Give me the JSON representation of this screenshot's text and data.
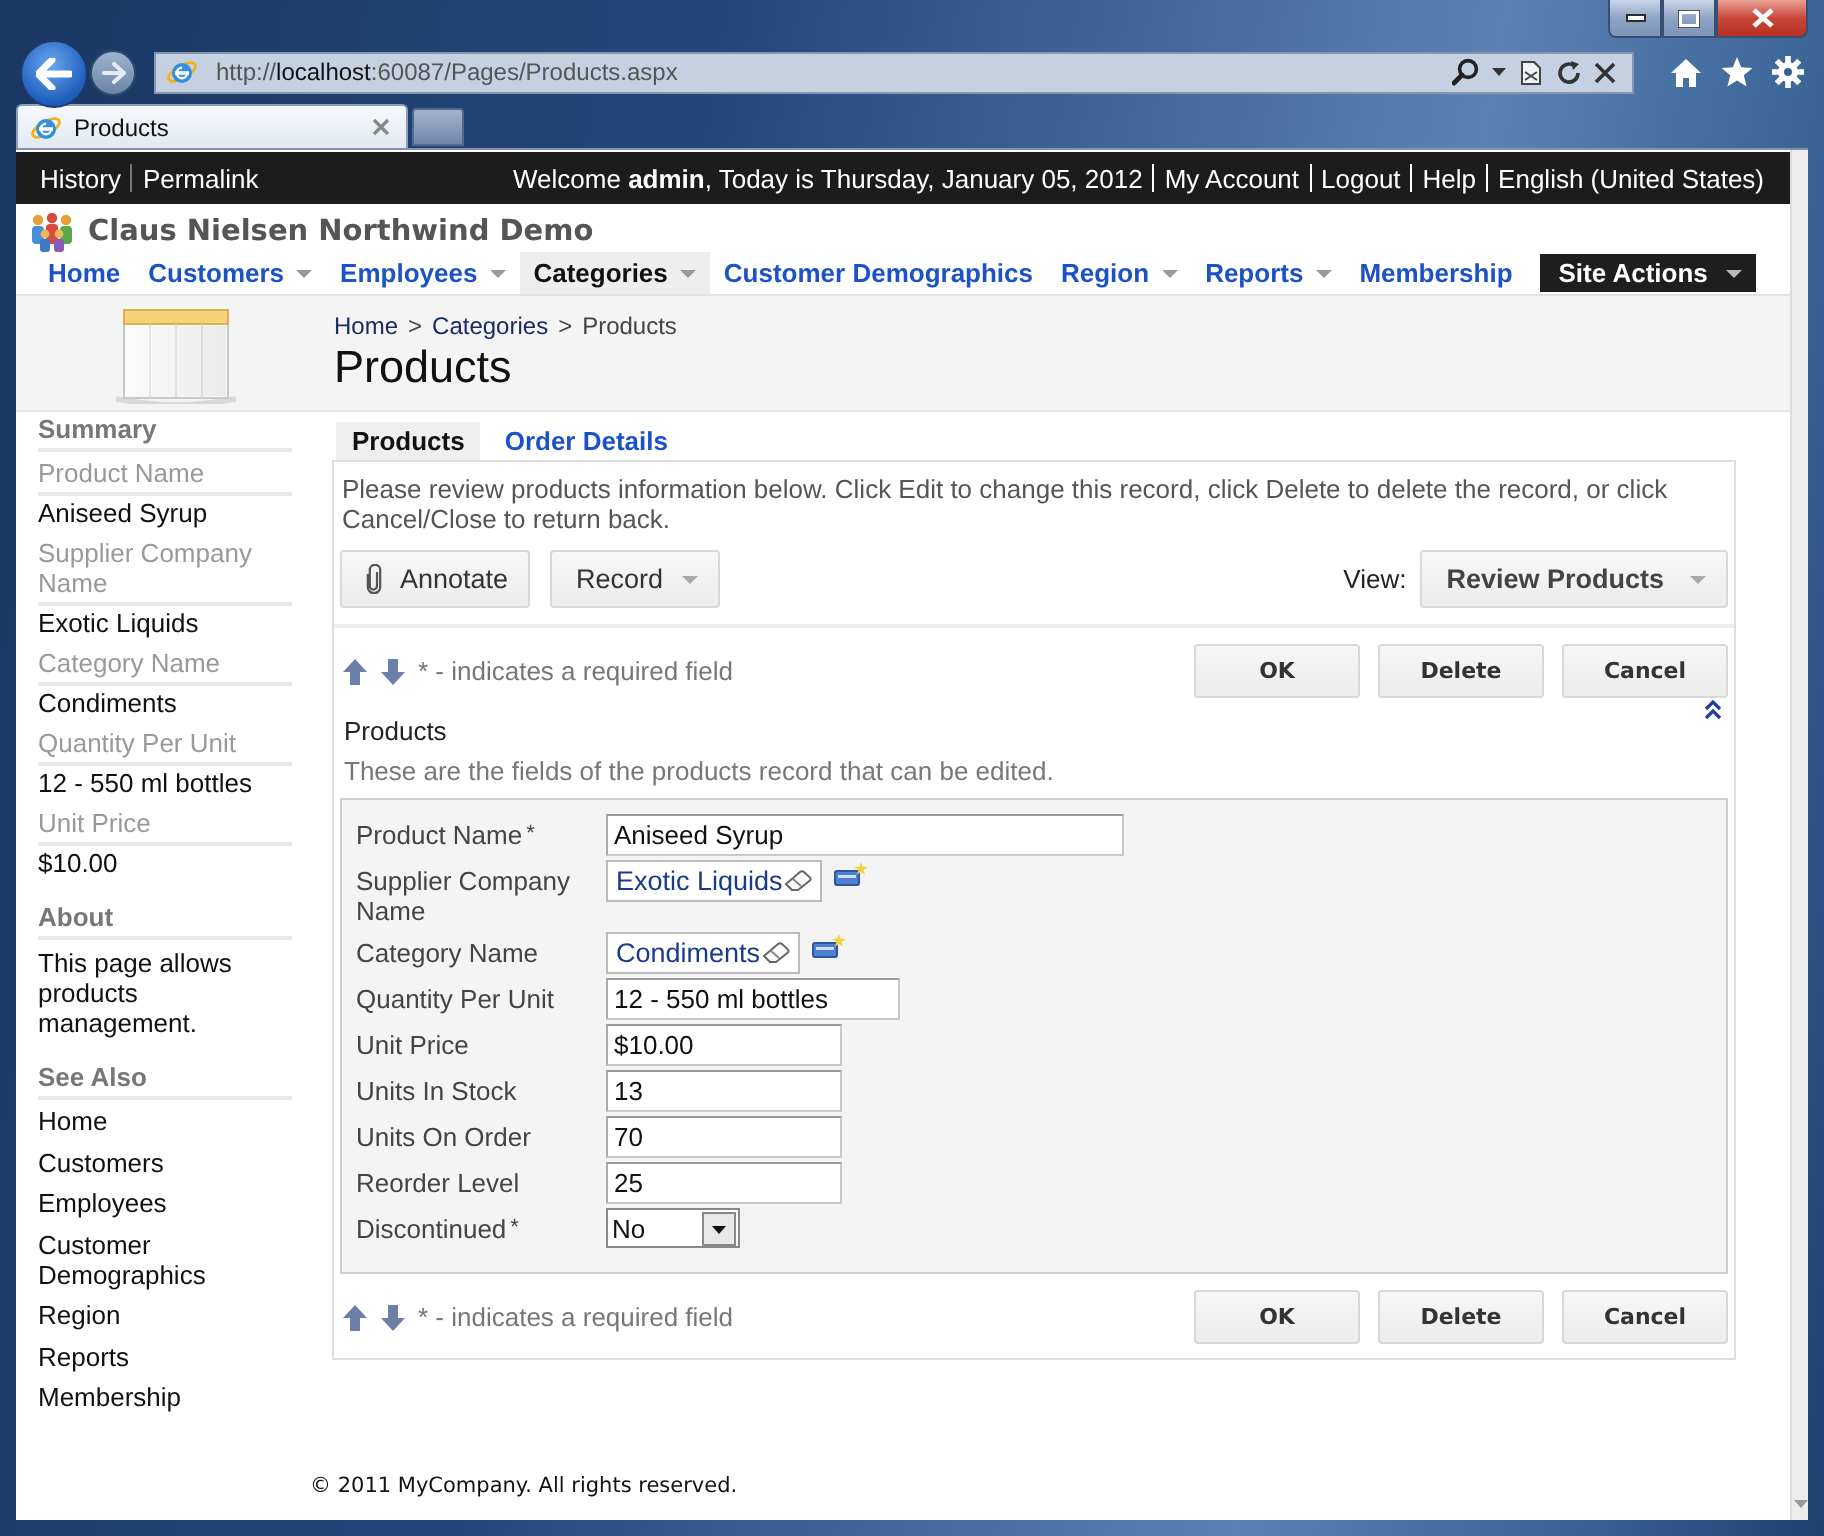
{
  "browser": {
    "address": "http://**localhost**:60087/Pages/Products.aspx",
    "tabs": [
      {
        "title": "Products",
        "selected": true
      }
    ]
  },
  "top_bar": {
    "left_links": [
      "History",
      "Permalink"
    ],
    "welcome": "Welcome **admin**, Today is Thursday, January 05, 2012",
    "right_links": [
      "My Account",
      "Logout",
      "Help",
      "English (United States)"
    ]
  },
  "site_title": "Claus Nielsen Northwind Demo",
  "menu": [
    {
      "label": "Home",
      "kind": "link",
      "dropdown": false,
      "selected": false
    },
    {
      "label": "Customers",
      "kind": "link",
      "dropdown": true,
      "selected": false
    },
    {
      "label": "Employees",
      "kind": "link",
      "dropdown": true,
      "selected": false
    },
    {
      "label": "Categories",
      "kind": "link",
      "dropdown": true,
      "selected": true
    },
    {
      "label": "Customer Demographics",
      "kind": "link",
      "dropdown": false,
      "selected": false
    },
    {
      "label": "Region",
      "kind": "link",
      "dropdown": true,
      "selected": false
    },
    {
      "label": "Reports",
      "kind": "link",
      "dropdown": true,
      "selected": false
    },
    {
      "label": "Membership",
      "kind": "link",
      "dropdown": false,
      "selected": false
    },
    {
      "label": "Site Actions",
      "kind": "action",
      "dropdown": true,
      "selected": false
    }
  ],
  "page_header": {
    "breadcrumb": [
      {
        "label": "Home",
        "kind": "link"
      },
      {
        "label": ">",
        "kind": "separator"
      },
      {
        "label": "Categories",
        "kind": "link"
      },
      {
        "label": ">",
        "kind": "separator"
      },
      {
        "label": "Products",
        "kind": "current"
      }
    ],
    "title": "Products"
  },
  "sidebar": {
    "summary": {
      "title": "Summary",
      "fields": [
        {
          "label": "Product Name",
          "value": "Aniseed Syrup"
        },
        {
          "label": "Supplier Company Name",
          "value": "Exotic Liquids"
        },
        {
          "label": "Category Name",
          "value": "Condiments"
        },
        {
          "label": "Quantity Per Unit",
          "value": "12 - 550 ml bottles"
        },
        {
          "label": "Unit Price",
          "value": "$10.00"
        }
      ]
    },
    "about": {
      "title": "About",
      "text": "This page allows products management."
    },
    "see_also": {
      "title": "See Also",
      "links": [
        "Home",
        "Customers",
        "Employees",
        "Customer Demographics",
        "Region",
        "Reports",
        "Membership"
      ]
    }
  },
  "tabs": [
    {
      "label": "Products",
      "selected": true
    },
    {
      "label": "Order Details",
      "selected": false
    }
  ],
  "instructions": "Please review products information below. Click Edit to change this record, click Delete to delete the record, or click Cancel/Close to return back.",
  "toolbar": {
    "buttons": [
      {
        "label": "Annotate",
        "kind": "annotate"
      },
      {
        "label": "Record",
        "kind": "menu"
      }
    ],
    "view_label": "View:",
    "view": "Review Products"
  },
  "action_bars": [
    {
      "note": "* - indicates a required field",
      "buttons": [
        "OK",
        "Delete",
        "Cancel"
      ]
    },
    {
      "note": "* - indicates a required field",
      "buttons": [
        "OK",
        "Delete",
        "Cancel"
      ]
    }
  ],
  "form": {
    "title": "Products",
    "description": "These are the fields of the products record that can be edited.",
    "fields": [
      {
        "label": "Product Name",
        "required_mark": "*",
        "kind": "longtext",
        "value": "Aniseed Syrup"
      },
      {
        "label": "Supplier Company Name",
        "kind": "lookup",
        "value": "Exotic Liquids"
      },
      {
        "label": "Category Name",
        "kind": "lookup",
        "value": "Condiments"
      },
      {
        "label": "Quantity Per Unit",
        "kind": "text",
        "value": "12 - 550 ml bottles"
      },
      {
        "label": "Unit Price",
        "kind": "number",
        "value": "$10.00"
      },
      {
        "label": "Units In Stock",
        "kind": "number",
        "value": "13"
      },
      {
        "label": "Units On Order",
        "kind": "number",
        "value": "70"
      },
      {
        "label": "Reorder Level",
        "kind": "number",
        "value": "25"
      },
      {
        "label": "Discontinued",
        "required_mark": "*",
        "kind": "select",
        "value": "No"
      }
    ]
  },
  "footer": "© 2011 MyCompany. All rights reserved."
}
